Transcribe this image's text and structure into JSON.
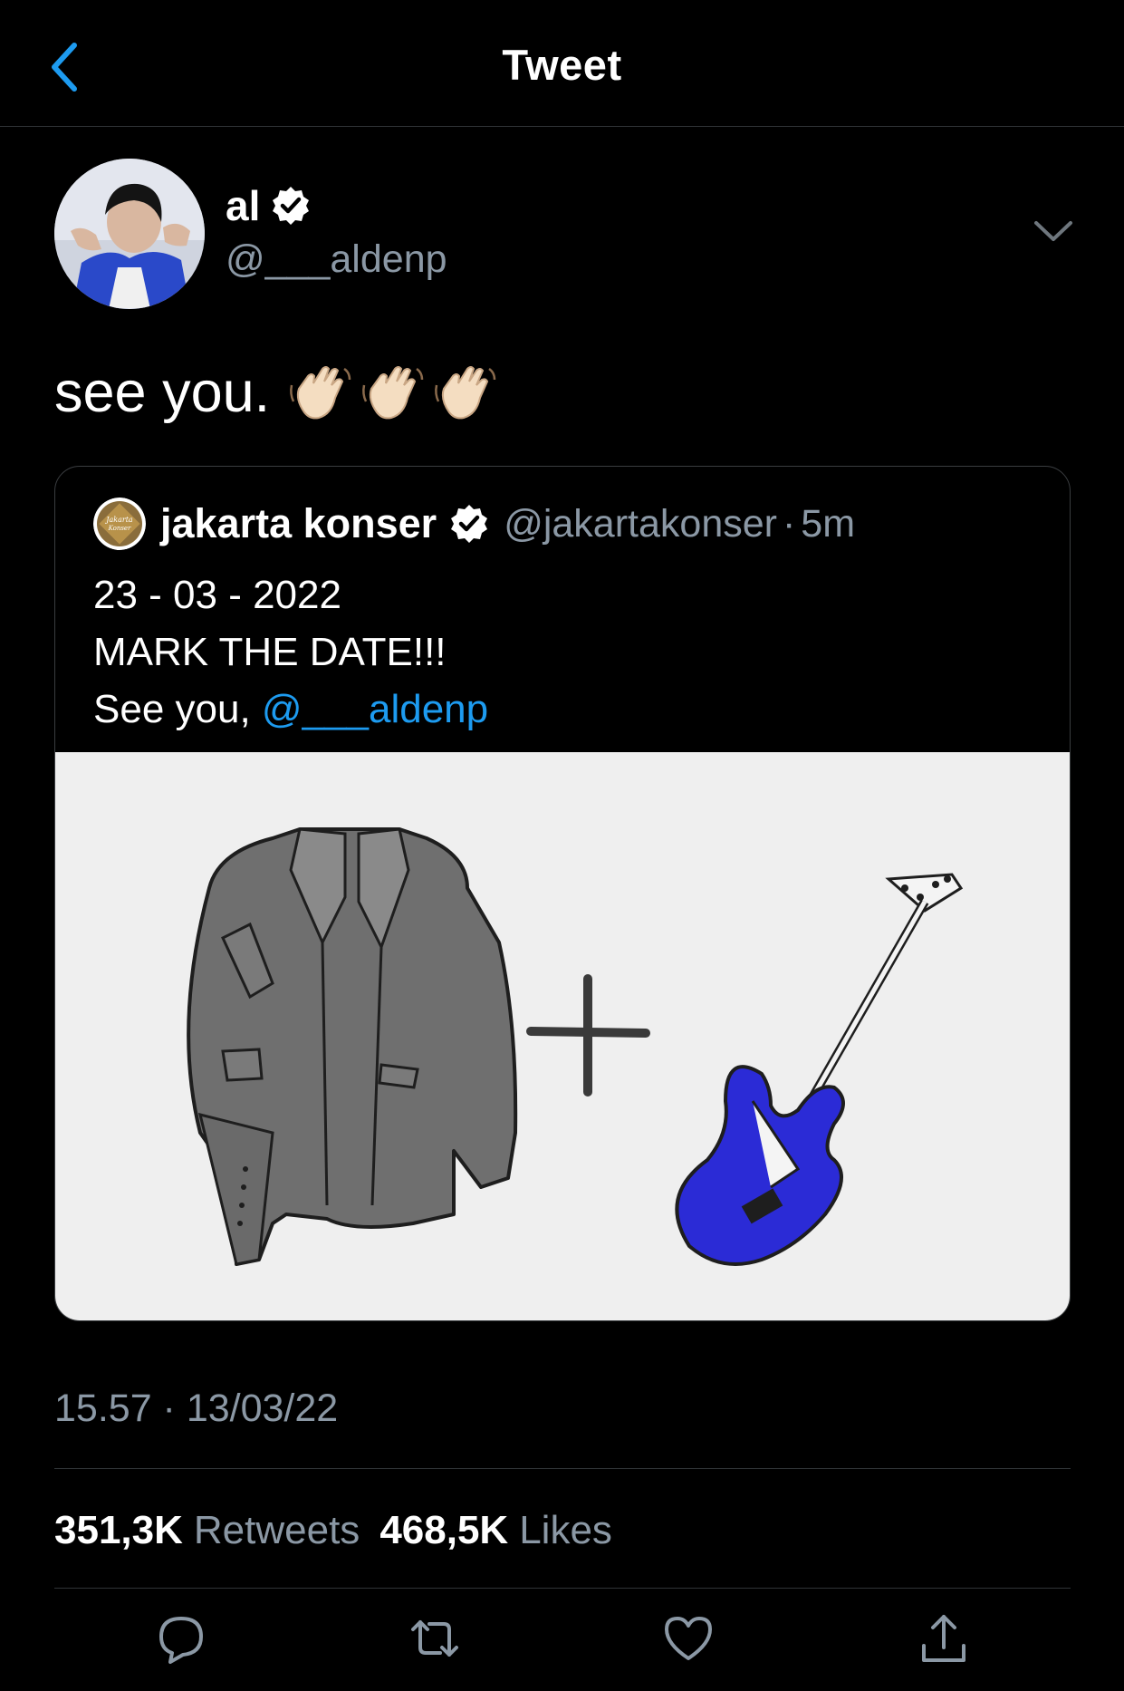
{
  "nav": {
    "title": "Tweet"
  },
  "author": {
    "name": "al",
    "handle": "@___aldenp"
  },
  "tweet": {
    "text": "see you."
  },
  "quoted": {
    "name": "jakarta konser",
    "handle": "@jakartakonser",
    "separator": "·",
    "time": "5m",
    "line1": "23 - 03 - 2022",
    "line2": "MARK THE DATE!!!",
    "line3_prefix": "See you, ",
    "mention": "@___aldenp",
    "avatar_text": "Jakarta Konser"
  },
  "meta": {
    "timestamp": "15.57 · 13/03/22"
  },
  "stats": {
    "retweets_count": "351,3K",
    "retweets_label": "Retweets",
    "likes_count": "468,5K",
    "likes_label": "Likes"
  },
  "icons": {
    "back": "chevron-left-icon",
    "verified": "verified-badge-icon",
    "more": "chevron-down-icon",
    "reply": "reply-icon",
    "retweet": "retweet-icon",
    "like": "heart-icon",
    "share": "share-icon"
  },
  "colors": {
    "background": "#000000",
    "accent": "#1d9bf0",
    "secondary_text": "#8b98a5",
    "divider": "#2f3336",
    "guitar_body": "#2b2bd6"
  }
}
